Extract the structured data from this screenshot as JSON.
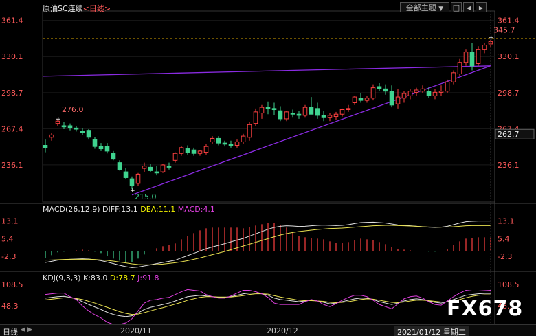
{
  "header": {
    "title": "原油SC连续",
    "period_prefix": "<",
    "period": "日线",
    "period_suffix": ">",
    "theme_button": "全部主题",
    "dropdown_glyph": "▼",
    "fullscreen_glyph": "□",
    "prev_glyph": "◀",
    "next_glyph": "▶"
  },
  "main_axis": {
    "ticks": [
      "361.4",
      "330.1",
      "298.7",
      "267.4",
      "236.1"
    ],
    "current_price": "262.7",
    "ref_price": "345.7"
  },
  "annotations": {
    "high": "276.0",
    "low": "215.0",
    "last_high": "345.7"
  },
  "macd": {
    "label": "MACD(26,12,9)",
    "diff_label": "DIFF:",
    "diff": "13.1",
    "dea_label": "DEA:",
    "dea": "11.1",
    "macd_label": "MACD:",
    "macd": "4.1",
    "ticks": [
      "13.1",
      "5.4",
      "-2.3"
    ]
  },
  "kdj": {
    "label": "KDJ(9,3,3)",
    "k_label": "K:",
    "k": "83.0",
    "d_label": "D:",
    "d": "78.7",
    "j_label": "J:",
    "j": "91.8",
    "ticks": [
      "108.5",
      "48.3"
    ]
  },
  "bottom": {
    "period": "日线",
    "arrow_left": "◀",
    "arrow_right": "▶",
    "dates": [
      "2020/11",
      "2020/12"
    ],
    "cursor_date": "2021/01/12 星期二"
  },
  "watermark": "FX678",
  "colors": {
    "up": "#ff4040",
    "down": "#3fd38f",
    "trendline": "#8a2be2",
    "diff_line": "#e0e0e0",
    "dea_line": "#e8e050",
    "kdj_j": "#e040e0",
    "text_yellow": "#f0f000",
    "text_white": "#dddddd",
    "text_purple": "#e040e0",
    "axis_label": "#ff5a5a"
  },
  "chart_data": {
    "type": "candlestick",
    "x_start": "2020-10-13",
    "x_end": "2021-01-12",
    "ylim": [
      205,
      366
    ],
    "ohlc": [
      [
        253,
        258,
        247,
        251
      ],
      [
        260,
        264,
        257,
        262
      ],
      [
        272,
        276,
        270,
        274
      ],
      [
        270,
        273,
        267,
        269
      ],
      [
        270,
        272,
        266,
        268
      ],
      [
        268,
        270,
        265,
        267
      ],
      [
        265,
        268,
        262,
        264
      ],
      [
        266,
        267,
        258,
        260
      ],
      [
        258,
        260,
        250,
        252
      ],
      [
        252,
        255,
        248,
        250
      ],
      [
        252,
        255,
        246,
        248
      ],
      [
        246,
        248,
        240,
        241
      ],
      [
        238,
        240,
        231,
        232
      ],
      [
        230,
        233,
        224,
        225
      ],
      [
        224,
        226,
        215,
        218
      ],
      [
        220,
        229,
        218,
        228
      ],
      [
        233,
        238,
        230,
        235
      ],
      [
        234,
        237,
        230,
        231
      ],
      [
        230,
        235,
        227,
        229
      ],
      [
        230,
        237,
        229,
        236
      ],
      [
        235,
        238,
        232,
        234
      ],
      [
        240,
        247,
        238,
        246
      ],
      [
        246,
        252,
        244,
        251
      ],
      [
        250,
        253,
        245,
        247
      ],
      [
        249,
        251,
        244,
        246
      ],
      [
        246,
        249,
        244,
        248
      ],
      [
        247,
        254,
        245,
        252
      ],
      [
        256,
        261,
        254,
        259
      ],
      [
        259,
        261,
        253,
        255
      ],
      [
        255,
        257,
        252,
        254
      ],
      [
        254,
        257,
        251,
        253
      ],
      [
        253,
        258,
        251,
        256
      ],
      [
        256,
        263,
        254,
        261
      ],
      [
        260,
        273,
        257,
        271
      ],
      [
        272,
        285,
        270,
        282
      ],
      [
        281,
        288,
        276,
        286
      ],
      [
        286,
        291,
        280,
        285
      ],
      [
        285,
        290,
        279,
        284
      ],
      [
        283,
        287,
        274,
        276
      ],
      [
        276,
        283,
        274,
        282
      ],
      [
        281,
        284,
        277,
        280
      ],
      [
        280,
        283,
        276,
        279
      ],
      [
        279,
        288,
        277,
        286
      ],
      [
        286,
        295,
        283,
        280
      ],
      [
        285,
        290,
        276,
        279
      ],
      [
        279,
        283,
        274,
        277
      ],
      [
        277,
        281,
        274,
        279
      ],
      [
        278,
        282,
        275,
        280
      ],
      [
        280,
        285,
        278,
        284
      ],
      [
        284,
        288,
        282,
        285
      ],
      [
        290,
        296,
        288,
        295
      ],
      [
        294,
        298,
        290,
        292
      ],
      [
        292,
        296,
        290,
        294
      ],
      [
        294,
        306,
        292,
        303
      ],
      [
        304,
        307,
        300,
        302
      ],
      [
        302,
        306,
        297,
        300
      ],
      [
        300,
        305,
        286,
        288
      ],
      [
        289,
        302,
        285,
        295
      ],
      [
        294,
        300,
        290,
        298
      ],
      [
        296,
        302,
        293,
        300
      ],
      [
        299,
        303,
        296,
        301
      ],
      [
        300,
        305,
        298,
        302
      ],
      [
        300,
        304,
        294,
        296
      ],
      [
        296,
        302,
        293,
        299
      ],
      [
        299,
        305,
        296,
        300
      ],
      [
        300,
        310,
        298,
        308
      ],
      [
        308,
        318,
        306,
        316
      ],
      [
        315,
        328,
        313,
        325
      ],
      [
        325,
        336,
        322,
        334
      ],
      [
        334,
        342,
        318,
        322
      ],
      [
        324,
        339,
        322,
        336
      ],
      [
        336,
        342,
        333,
        340
      ],
      [
        341,
        346,
        338,
        343
      ]
    ],
    "trendlines": [
      {
        "points": [
          [
            0,
            313
          ],
          [
            72,
            322
          ]
        ],
        "note": "upper boundary"
      },
      {
        "points": [
          [
            14,
            210
          ],
          [
            72,
            322
          ]
        ],
        "note": "rising support"
      }
    ],
    "macd": {
      "ylim": [
        -8,
        16
      ],
      "diff": [
        -5,
        -4.5,
        -4,
        -3.8,
        -3.6,
        -3.5,
        -3.4,
        -3.5,
        -3.8,
        -4.2,
        -4.8,
        -5.5,
        -6.2,
        -6.8,
        -7.2,
        -7,
        -6.5,
        -6,
        -5.5,
        -5,
        -4.5,
        -4,
        -3,
        -2,
        -1,
        0,
        1,
        1.8,
        2.5,
        3.2,
        4,
        4.8,
        5.5,
        6.5,
        7.5,
        8.5,
        9.5,
        10.3,
        10.8,
        11,
        10.9,
        10.7,
        10.8,
        11,
        11.2,
        11.3,
        11.2,
        11.1,
        11.2,
        11.5,
        12,
        12.4,
        12.5,
        12.6,
        12.4,
        12.2,
        11.8,
        11.4,
        11.2,
        11,
        10.8,
        10.6,
        10.4,
        10.3,
        10.4,
        10.8,
        11.5,
        12.2,
        12.8,
        13,
        13.1,
        13.1,
        13.1
      ],
      "dea": [
        -4,
        -3.9,
        -3.8,
        -3.7,
        -3.6,
        -3.6,
        -3.6,
        -3.6,
        -3.7,
        -3.9,
        -4.1,
        -4.4,
        -4.8,
        -5.2,
        -5.6,
        -5.9,
        -6,
        -6,
        -5.9,
        -5.7,
        -5.4,
        -5.1,
        -4.7,
        -4.2,
        -3.6,
        -3,
        -2.3,
        -1.6,
        -0.9,
        -0.2,
        0.6,
        1.4,
        2.2,
        3,
        3.8,
        4.6,
        5.4,
        6.2,
        7,
        7.6,
        8.1,
        8.5,
        8.8,
        9.1,
        9.4,
        9.6,
        9.8,
        9.9,
        10,
        10.2,
        10.4,
        10.6,
        10.8,
        11,
        11.1,
        11.2,
        11.2,
        11.1,
        11,
        10.9,
        10.8,
        10.6,
        10.5,
        10.4,
        10.4,
        10.5,
        10.6,
        10.8,
        11,
        11.1,
        11.1,
        11.1,
        11.1
      ],
      "hist": [
        -1,
        -0.6,
        -0.2,
        -0.1,
        0,
        0.1,
        0.2,
        0.1,
        -0.1,
        -0.3,
        -0.7,
        -1.1,
        -1.4,
        -1.6,
        -1.6,
        -1.1,
        -0.5,
        0,
        0.4,
        0.7,
        0.9,
        1.1,
        1.7,
        2.2,
        2.6,
        3,
        3.3,
        3.4,
        3.4,
        3.4,
        3.4,
        3.4,
        3.3,
        3.5,
        3.7,
        3.9,
        4.1,
        4.1,
        3.8,
        3.4,
        2.8,
        2.2,
        2,
        1.9,
        1.8,
        1.7,
        1.4,
        1.2,
        1.2,
        1.3,
        1.6,
        1.8,
        1.7,
        1.6,
        1.3,
        1,
        0.6,
        0.3,
        0.2,
        0.1,
        0,
        0,
        -0.1,
        -0.1,
        0,
        0.3,
        0.9,
        1.4,
        1.8,
        1.9,
        2,
        2,
        2
      ]
    },
    "kdj": {
      "ylim": [
        0,
        120
      ],
      "k": [
        70,
        72,
        74,
        75,
        72,
        68,
        60,
        52,
        45,
        38,
        30,
        24,
        20,
        18,
        20,
        28,
        38,
        44,
        48,
        52,
        56,
        62,
        68,
        74,
        76,
        78,
        76,
        74,
        72,
        72,
        74,
        78,
        82,
        84,
        84,
        82,
        78,
        70,
        66,
        64,
        62,
        60,
        62,
        64,
        62,
        58,
        54,
        56,
        60,
        64,
        68,
        70,
        70,
        66,
        60,
        56,
        52,
        56,
        62,
        66,
        68,
        66,
        62,
        58,
        56,
        60,
        66,
        72,
        78,
        80,
        82,
        83,
        83
      ],
      "d": [
        65,
        67,
        69,
        71,
        71,
        69,
        66,
        61,
        56,
        50,
        44,
        38,
        32,
        27,
        24,
        25,
        29,
        34,
        39,
        43,
        48,
        53,
        58,
        64,
        68,
        72,
        74,
        74,
        73,
        73,
        73,
        75,
        77,
        80,
        82,
        82,
        81,
        77,
        73,
        70,
        67,
        64,
        63,
        63,
        62,
        61,
        58,
        57,
        58,
        60,
        63,
        66,
        68,
        67,
        64,
        61,
        58,
        57,
        59,
        62,
        64,
        64,
        63,
        61,
        59,
        59,
        62,
        66,
        71,
        75,
        78,
        79,
        79
      ],
      "j": [
        80,
        82,
        84,
        84,
        74,
        66,
        48,
        34,
        23,
        14,
        2,
        -4,
        -4,
        0,
        12,
        34,
        56,
        64,
        66,
        70,
        72,
        80,
        88,
        94,
        92,
        90,
        80,
        74,
        70,
        70,
        76,
        84,
        92,
        92,
        88,
        82,
        72,
        56,
        52,
        52,
        52,
        52,
        60,
        66,
        62,
        52,
        46,
        54,
        64,
        72,
        78,
        78,
        74,
        64,
        52,
        46,
        40,
        54,
        68,
        74,
        76,
        70,
        60,
        52,
        50,
        62,
        74,
        84,
        92,
        90,
        90,
        91,
        92
      ]
    }
  }
}
